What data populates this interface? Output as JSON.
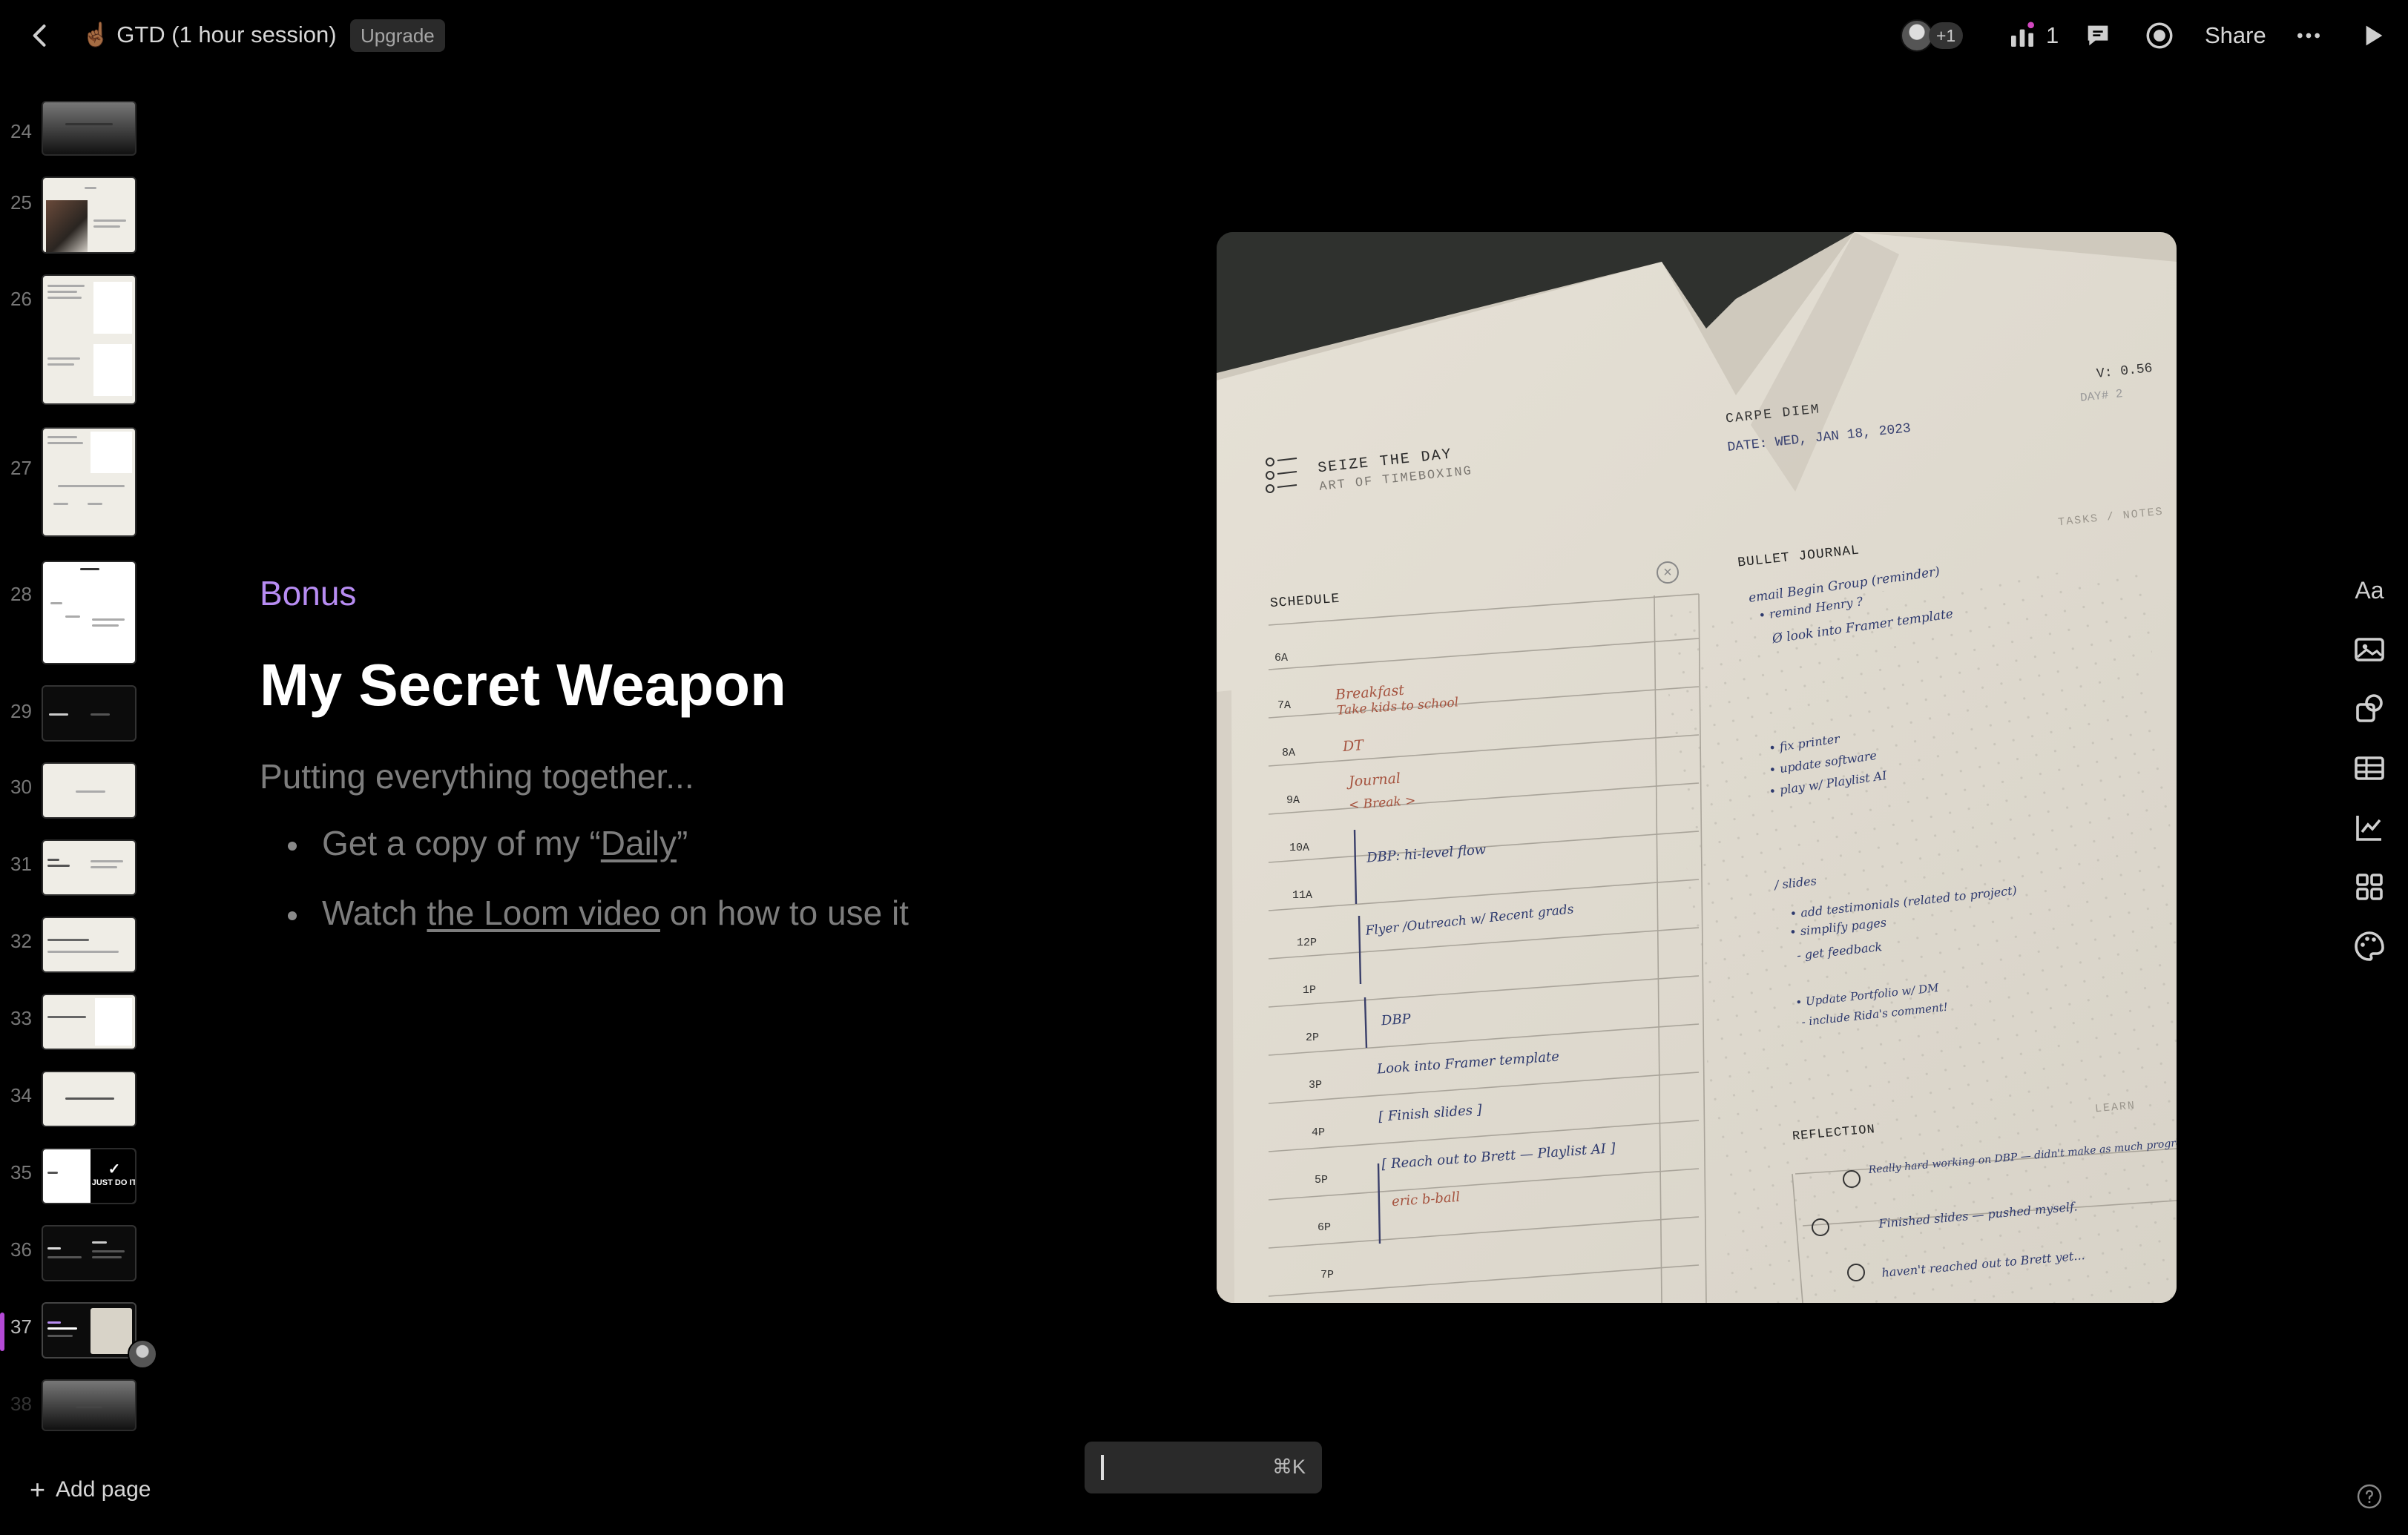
{
  "topbar": {
    "doc_title": "☝🏾 GTD (1 hour session)",
    "upgrade_label": "Upgrade",
    "collaborators_extra": "+1",
    "analytics_count": "1",
    "share_label": "Share"
  },
  "sidebar": {
    "slides": [
      {
        "number": "24",
        "style": "grad"
      },
      {
        "number": "25",
        "style": "light-photo"
      },
      {
        "number": "26",
        "style": "light"
      },
      {
        "number": "27",
        "style": "light"
      },
      {
        "number": "28",
        "style": "light"
      },
      {
        "number": "29",
        "style": "dark"
      },
      {
        "number": "30",
        "style": "light"
      },
      {
        "number": "31",
        "style": "light"
      },
      {
        "number": "32",
        "style": "light"
      },
      {
        "number": "33",
        "style": "light"
      },
      {
        "number": "34",
        "style": "light"
      },
      {
        "number": "35",
        "style": "nike",
        "badge": "JUST DO IT"
      },
      {
        "number": "36",
        "style": "dark"
      },
      {
        "number": "37",
        "style": "dark-photo",
        "active": true
      },
      {
        "number": "38",
        "style": "grad"
      }
    ],
    "add_page_label": "Add page"
  },
  "slide": {
    "kicker": "Bonus",
    "title": "My Secret Weapon",
    "subtitle": "Putting everything together...",
    "bullets": [
      {
        "prefix": "Get a copy of my “",
        "link": "Daily",
        "suffix": "”"
      },
      {
        "prefix": "Watch ",
        "link": "the Loom video",
        "suffix": " on how to use it"
      }
    ]
  },
  "photo": {
    "sheet_left_title": "SEIZE THE DAY",
    "sheet_left_subtitle": "ART OF TIMEBOXING",
    "version": "V: 0.56",
    "day_label": "DAY# 2",
    "carpe": "CARPE DIEM",
    "date_line": "DATE: WED, JAN 18, 2023",
    "tasks_notes": "TASKS / NOTES",
    "schedule": "SCHEDULE",
    "bullet_journal": "BULLET JOURNAL",
    "reflection": "REFLECTION",
    "learn": "LEARN",
    "hours": [
      "6A",
      "7A",
      "8A",
      "9A",
      "10A",
      "11A",
      "12P",
      "1P",
      "2P",
      "3P",
      "4P",
      "5P",
      "6P",
      "7P"
    ],
    "schedule_entries": [
      {
        "text": "Breakfast",
        "color": "#a5533f"
      },
      {
        "text": "Take kids to school",
        "color": "#a5533f"
      },
      {
        "text": "DT",
        "color": "#a5533f"
      },
      {
        "text": "Journal",
        "color": "#a5533f"
      },
      {
        "text": "< Break >",
        "color": "#a5533f"
      },
      {
        "text": "DBP: hi-level flow",
        "color": "#2e3a6e"
      },
      {
        "text": "Flyer /Outreach w/ Recent grads",
        "color": "#2e3a6e"
      },
      {
        "text": "DBP",
        "color": "#2e3a6e"
      },
      {
        "text": "Look into Framer template",
        "color": "#2e3a6e"
      },
      {
        "text": "[ Finish slides ]",
        "color": "#2e3a6e"
      },
      {
        "text": "[ Reach out to Brett — Playlist AI ]",
        "color": "#2e3a6e"
      },
      {
        "text": "eric b-ball",
        "color": "#a5533f"
      }
    ],
    "journal_entries": [
      "email Begin Group (reminder)",
      "• remind Henry ?",
      "Ø look into Framer template",
      "• fix printer",
      "• update software",
      "• play w/ Playlist AI",
      "/ slides",
      "• add testimonials (related to project)",
      "• simplify pages",
      "- get feedback",
      "• Update Portfolio w/ DM",
      "- include Rida's comment!"
    ],
    "reflection_entries": [
      "Really hard working on DBP — didn't make as much progress",
      "Finished slides — pushed myself.",
      "haven't reached out to Brett yet..."
    ]
  },
  "right_toolbar": [
    "text-icon",
    "image-icon",
    "shapes-icon",
    "table-icon",
    "chart-icon",
    "apps-icon",
    "palette-icon"
  ],
  "command_bar": {
    "shortcut": "⌘K"
  }
}
